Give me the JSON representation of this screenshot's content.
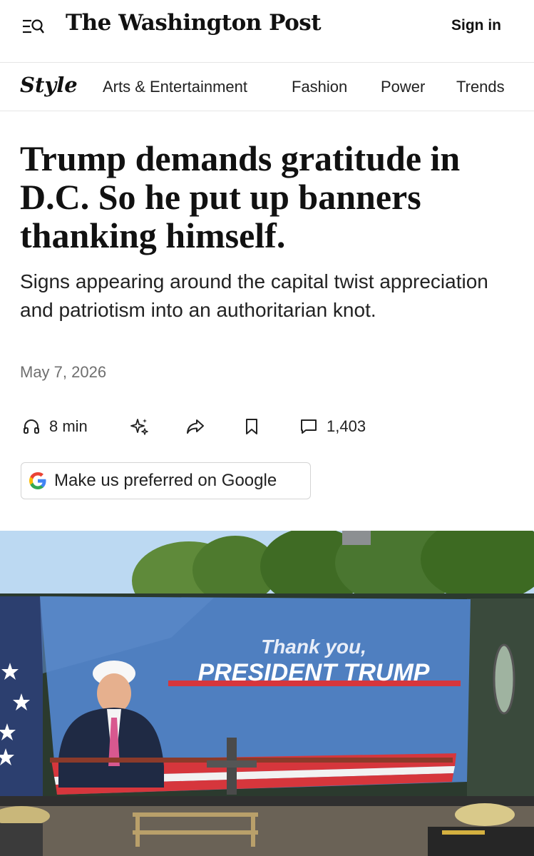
{
  "header": {
    "logo": "The Washington Post",
    "sign_in": "Sign in"
  },
  "section": {
    "name": "Style",
    "nav": [
      "Arts & Entertainment",
      "Fashion",
      "Power",
      "Trends"
    ]
  },
  "article": {
    "headline": "Trump demands gratitude in D.C. So he put up banners thanking himself.",
    "dek": "Signs appearing around the capital twist appreciation and patriotism into an authoritarian knot.",
    "date": "May 7, 2026",
    "listen_time": "8 min",
    "comment_count": "1,403",
    "google_button": "Make us preferred on Google"
  },
  "photo": {
    "banner_line1": "Thank you,",
    "banner_line2": "PRESIDENT TRUMP"
  },
  "icons": [
    "menu-search-icon",
    "headphones-icon",
    "sparkle-icon",
    "share-icon",
    "bookmark-icon",
    "comment-icon",
    "google-g-icon"
  ],
  "colors": {
    "banner_blue": "#4f7fc0",
    "banner_red": "#d6363c",
    "sky": "#bcd9f2"
  }
}
